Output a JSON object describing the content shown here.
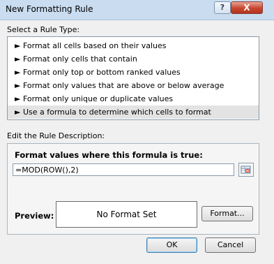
{
  "window": {
    "title": "New Formatting Rule",
    "help_label": "?",
    "close_label": "X"
  },
  "rule_type": {
    "heading": "Select a Rule Type:",
    "items": [
      {
        "label": "► Format all cells based on their values"
      },
      {
        "label": "► Format only cells that contain"
      },
      {
        "label": "► Format only top or bottom ranked values"
      },
      {
        "label": "► Format only values that are above or below average"
      },
      {
        "label": "► Format only unique or duplicate values"
      },
      {
        "label": "► Use a formula to determine which cells to format"
      }
    ],
    "selected_index": 5
  },
  "description": {
    "heading": "Edit the Rule Description:",
    "formula_label": "Format values where this formula is true:",
    "formula_value": "=MOD(ROW(),2)",
    "preview_label": "Preview:",
    "preview_text": "No Format Set",
    "format_button": "Format..."
  },
  "buttons": {
    "ok": "OK",
    "cancel": "Cancel"
  }
}
